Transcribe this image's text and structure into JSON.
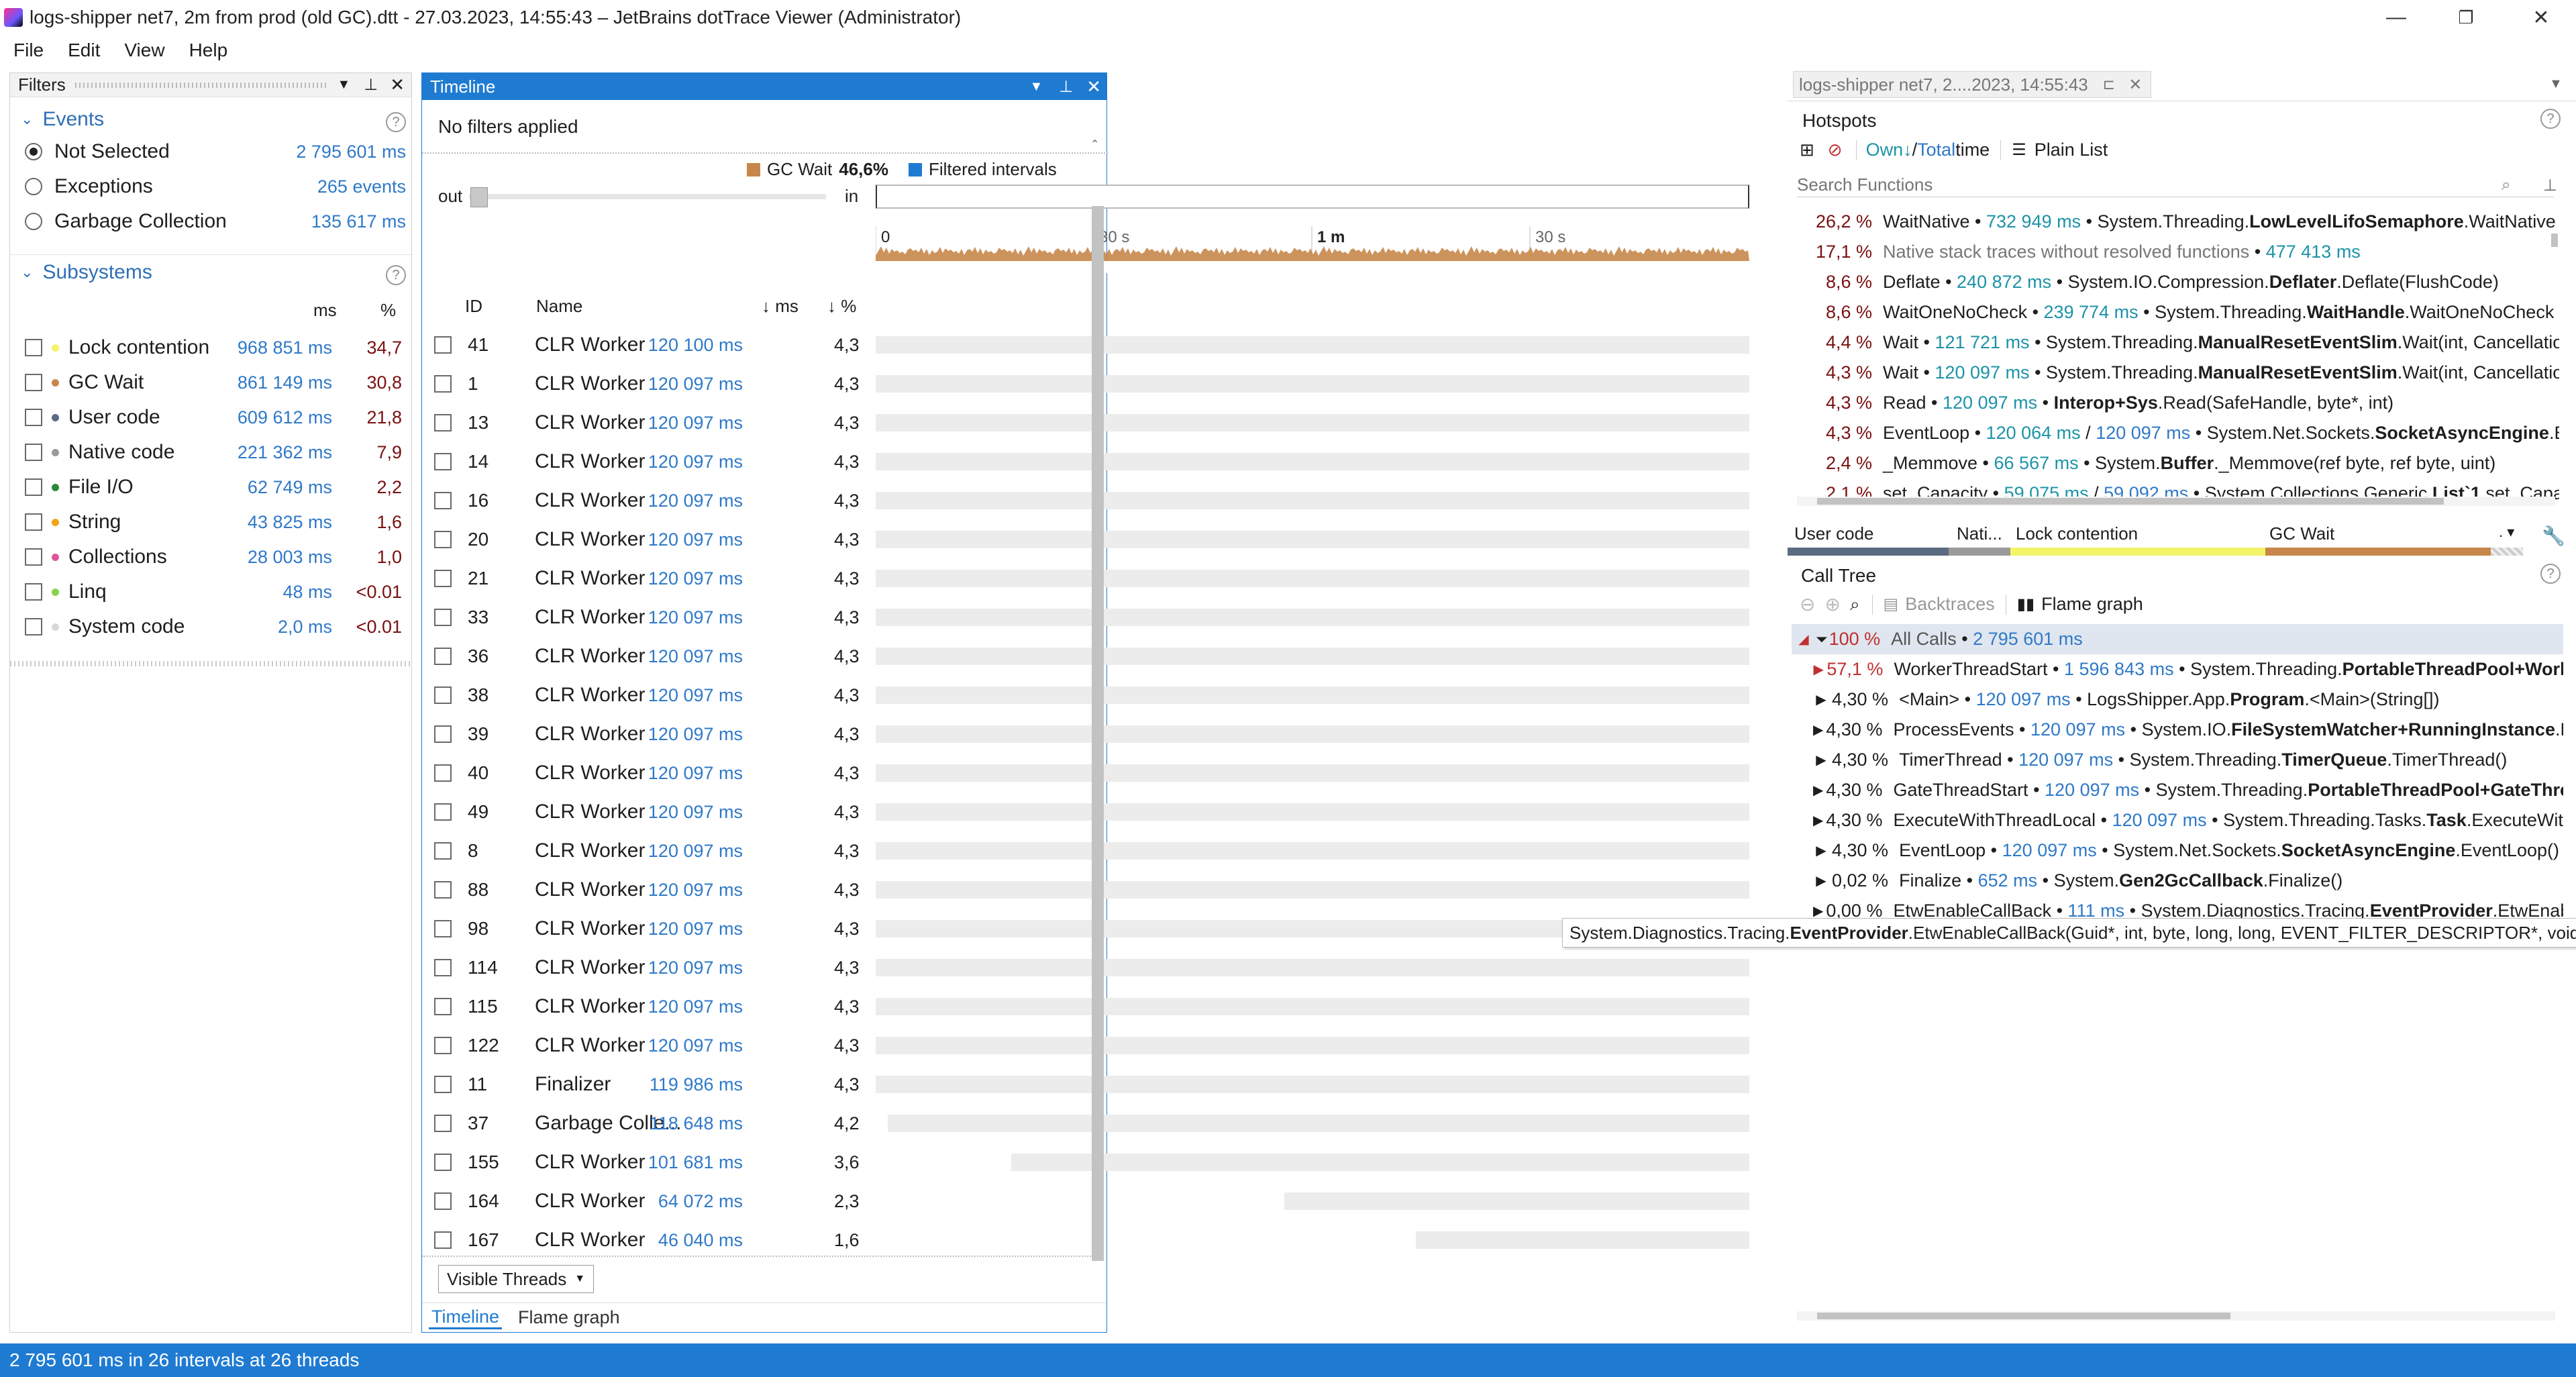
{
  "window": {
    "title": "logs-shipper net7, 2m from prod (old GC).dtt - 27.03.2023, 14:55:43 – JetBrains dotTrace Viewer (Administrator)",
    "minimize": "—",
    "maximize": "❐",
    "close": "✕"
  },
  "menu": [
    "File",
    "Edit",
    "View",
    "Help"
  ],
  "filters": {
    "title": "Filters",
    "events_label": "Events",
    "events": [
      {
        "label": "Not Selected",
        "value": "2 795 601 ms",
        "selected": true
      },
      {
        "label": "Exceptions",
        "value": "265 events",
        "selected": false
      },
      {
        "label": "Garbage Collection",
        "value": "135 617 ms",
        "selected": false
      }
    ],
    "subsystems_label": "Subsystems",
    "col_ms": "ms",
    "col_pct": "%",
    "subsystems": [
      {
        "label": "Lock contention",
        "ms": "968 851 ms",
        "pct": "34,7",
        "color": "#f4f46a"
      },
      {
        "label": "GC Wait",
        "ms": "861 149 ms",
        "pct": "30,8",
        "color": "#c8874a"
      },
      {
        "label": "User code",
        "ms": "609 612 ms",
        "pct": "21,8",
        "color": "#5b6b82"
      },
      {
        "label": "Native code",
        "ms": "221 362 ms",
        "pct": "7,9",
        "color": "#9a9a9a"
      },
      {
        "label": "File I/O",
        "ms": "62 749 ms",
        "pct": "2,2",
        "color": "#2b8a3a"
      },
      {
        "label": "String",
        "ms": "43 825 ms",
        "pct": "1,6",
        "color": "#f2a312"
      },
      {
        "label": "Collections",
        "ms": "28 003 ms",
        "pct": "1,0",
        "color": "#e0559a"
      },
      {
        "label": "Linq",
        "ms": "48 ms",
        "pct": "<0.01",
        "color": "#8ad14a"
      },
      {
        "label": "System code",
        "ms": "2,0 ms",
        "pct": "<0.01",
        "color": "#d8d8d8"
      }
    ]
  },
  "timeline": {
    "title": "Timeline",
    "no_filters": "No filters applied",
    "legend_gc": "GC Wait",
    "legend_gc_pct": "46,6%",
    "legend_filtered": "Filtered intervals",
    "zoom_out": "out",
    "zoom_in": "in",
    "ticks": [
      "0",
      "30 s",
      "1 m",
      "30 s"
    ],
    "col_id": "ID",
    "col_name": "Name",
    "col_ms": "↓ ms",
    "col_pct": "↓ %",
    "threads": [
      {
        "id": "41",
        "name": "CLR Worker",
        "ms": "120 100 ms",
        "pct": "4,3",
        "start": 0
      },
      {
        "id": "1",
        "name": "CLR Worker",
        "ms": "120 097 ms",
        "pct": "4,3",
        "start": 0
      },
      {
        "id": "13",
        "name": "CLR Worker",
        "ms": "120 097 ms",
        "pct": "4,3",
        "start": 0
      },
      {
        "id": "14",
        "name": "CLR Worker",
        "ms": "120 097 ms",
        "pct": "4,3",
        "start": 0
      },
      {
        "id": "16",
        "name": "CLR Worker",
        "ms": "120 097 ms",
        "pct": "4,3",
        "start": 0
      },
      {
        "id": "20",
        "name": "CLR Worker",
        "ms": "120 097 ms",
        "pct": "4,3",
        "start": 0
      },
      {
        "id": "21",
        "name": "CLR Worker",
        "ms": "120 097 ms",
        "pct": "4,3",
        "start": 0
      },
      {
        "id": "33",
        "name": "CLR Worker",
        "ms": "120 097 ms",
        "pct": "4,3",
        "start": 0
      },
      {
        "id": "36",
        "name": "CLR Worker",
        "ms": "120 097 ms",
        "pct": "4,3",
        "start": 0
      },
      {
        "id": "38",
        "name": "CLR Worker",
        "ms": "120 097 ms",
        "pct": "4,3",
        "start": 0
      },
      {
        "id": "39",
        "name": "CLR Worker",
        "ms": "120 097 ms",
        "pct": "4,3",
        "start": 0
      },
      {
        "id": "40",
        "name": "CLR Worker",
        "ms": "120 097 ms",
        "pct": "4,3",
        "start": 0
      },
      {
        "id": "49",
        "name": "CLR Worker",
        "ms": "120 097 ms",
        "pct": "4,3",
        "start": 0
      },
      {
        "id": "8",
        "name": "CLR Worker",
        "ms": "120 097 ms",
        "pct": "4,3",
        "start": 0
      },
      {
        "id": "88",
        "name": "CLR Worker",
        "ms": "120 097 ms",
        "pct": "4,3",
        "start": 0
      },
      {
        "id": "98",
        "name": "CLR Worker",
        "ms": "120 097 ms",
        "pct": "4,3",
        "start": 0
      },
      {
        "id": "114",
        "name": "CLR Worker",
        "ms": "120 097 ms",
        "pct": "4,3",
        "start": 0
      },
      {
        "id": "115",
        "name": "CLR Worker",
        "ms": "120 097 ms",
        "pct": "4,3",
        "start": 0
      },
      {
        "id": "122",
        "name": "CLR Worker",
        "ms": "120 097 ms",
        "pct": "4,3",
        "start": 0
      },
      {
        "id": "11",
        "name": "Finalizer",
        "ms": "119 986 ms",
        "pct": "4,3",
        "start": 0
      },
      {
        "id": "37",
        "name": "Garbage Colle...",
        "ms": "118 648 ms",
        "pct": "4,2",
        "start": 0.014
      },
      {
        "id": "155",
        "name": "CLR Worker",
        "ms": "101 681 ms",
        "pct": "3,6",
        "start": 0.155
      },
      {
        "id": "164",
        "name": "CLR Worker",
        "ms": "64 072 ms",
        "pct": "2,3",
        "start": 0.468
      },
      {
        "id": "167",
        "name": "CLR Worker",
        "ms": "46 040 ms",
        "pct": "1,6",
        "start": 0.618
      }
    ],
    "visible_threads": "Visible Threads",
    "tab_timeline": "Timeline",
    "tab_flame": "Flame graph"
  },
  "right_tab": "logs-shipper net7, 2....2023, 14:55:43",
  "hotspots": {
    "title": "Hotspots",
    "own": "Own↓",
    "slash": " / ",
    "total": "Total",
    "time": " time",
    "plain_list": "Plain List",
    "search_placeholder": "Search Functions",
    "rows": [
      {
        "pct": "26,2 %",
        "name": "WaitNative",
        "ms": "732 949 ms",
        "ns": "System.Threading.",
        "cls": "LowLevelLifoSemaphore",
        "rest": ".WaitNative"
      },
      {
        "pct": "17,1 %",
        "name": "Native stack traces without resolved functions",
        "ms": "477 413 ms",
        "ns": "",
        "cls": "",
        "rest": "",
        "gray": true
      },
      {
        "pct": "8,6 %",
        "name": "Deflate",
        "ms": "240 872 ms",
        "ns": "System.IO.Compression.",
        "cls": "Deflater",
        "rest": ".Deflate(FlushCode)"
      },
      {
        "pct": "8,6 %",
        "name": "WaitOneNoCheck",
        "ms": "239 774 ms",
        "ns": "System.Threading.",
        "cls": "WaitHandle",
        "rest": ".WaitOneNoCheck"
      },
      {
        "pct": "4,4 %",
        "name": "Wait",
        "ms": "121 721 ms",
        "ns": "System.Threading.",
        "cls": "ManualResetEventSlim",
        "rest": ".Wait(int, Cancellatio"
      },
      {
        "pct": "4,3 %",
        "name": "Wait",
        "ms": "120 097 ms",
        "ns": "System.Threading.",
        "cls": "ManualResetEventSlim",
        "rest": ".Wait(int, Cancellatio"
      },
      {
        "pct": "4,3 %",
        "name": "Read",
        "ms": "120 097 ms",
        "ns": "",
        "cls": "Interop+Sys",
        "rest": ".Read(SafeHandle, byte*, int)"
      },
      {
        "pct": "4,3 %",
        "name": "EventLoop",
        "ms": "120 064 ms",
        "ms2": "120 097 ms",
        "ns": "System.Net.Sockets.",
        "cls": "SocketAsyncEngine",
        "rest": ".E"
      },
      {
        "pct": "2,4 %",
        "name": "_Memmove",
        "ms": "66 567 ms",
        "ns": "System.",
        "cls": "Buffer",
        "rest": "._Memmove(ref byte, ref byte, uint)"
      },
      {
        "pct": "2,1 %",
        "name": "set_Capacity",
        "ms": "59 075 ms",
        "ms2": "59 092 ms",
        "ns": "System.Collections.Generic.",
        "cls": "List`1",
        "rest": ".set_Capac"
      }
    ]
  },
  "subsys_strip": {
    "user_code": "User code",
    "native": "Nati...",
    "lock": "Lock contention",
    "gc": "GC Wait",
    "more": ". ▾"
  },
  "calltree": {
    "title": "Call Tree",
    "backtraces": "Backtraces",
    "flame_graph": "Flame graph",
    "rows": [
      {
        "pct": "100 %",
        "name": "All Calls",
        "ms": "2 795 601 ms",
        "ns": "",
        "cls": "",
        "rest": "",
        "root": true
      },
      {
        "pct": "57,1 %",
        "name": "WorkerThreadStart",
        "ms": "1 596 843 ms",
        "ns": "System.Threading.",
        "cls": "PortableThreadPool+Work",
        "rest": ""
      },
      {
        "pct": "4,30 %",
        "name": "<Main>",
        "ms": "120 097 ms",
        "ns": "LogsShipper.App.",
        "cls": "Program",
        "rest": ".<Main>(String[])"
      },
      {
        "pct": "4,30 %",
        "name": "ProcessEvents",
        "ms": "120 097 ms",
        "ns": "System.IO.",
        "cls": "FileSystemWatcher+RunningInstance",
        "rest": ".Pro"
      },
      {
        "pct": "4,30 %",
        "name": "TimerThread",
        "ms": "120 097 ms",
        "ns": "System.Threading.",
        "cls": "TimerQueue",
        "rest": ".TimerThread()"
      },
      {
        "pct": "4,30 %",
        "name": "GateThreadStart",
        "ms": "120 097 ms",
        "ns": "System.Threading.",
        "cls": "PortableThreadPool+GateThre",
        "rest": ""
      },
      {
        "pct": "4,30 %",
        "name": "ExecuteWithThreadLocal",
        "ms": "120 097 ms",
        "ns": "System.Threading.Tasks.",
        "cls": "Task",
        "rest": ".ExecuteWithT"
      },
      {
        "pct": "4,30 %",
        "name": "EventLoop",
        "ms": "120 097 ms",
        "ns": "System.Net.Sockets.",
        "cls": "SocketAsyncEngine",
        "rest": ".EventLoop()"
      },
      {
        "pct": "0,02 %",
        "name": "Finalize",
        "ms": "652 ms",
        "ns": "System.",
        "cls": "Gen2GcCallback",
        "rest": ".Finalize()"
      },
      {
        "pct": "0,00 %",
        "name": "EtwEnableCallBack",
        "ms": "111 ms",
        "ns": "System.Diagnostics.Tracing.",
        "cls": "EventProvider",
        "rest": ".EtwEnableC"
      }
    ],
    "tooltip_ns": "System.Diagnostics.Tracing.",
    "tooltip_cls": "EventProvider",
    "tooltip_rest": ".EtwEnableCallBack(Guid*, int, byte, long, long, EVENT_FILTER_DESCRIPTOR*, void*)"
  },
  "status": "2 795 601 ms in 26 intervals at 26 threads",
  "colors": {
    "accent": "#1f7bd2",
    "gc": "#c8874a",
    "lock": "#f4f46a",
    "user": "#5b6b82"
  }
}
